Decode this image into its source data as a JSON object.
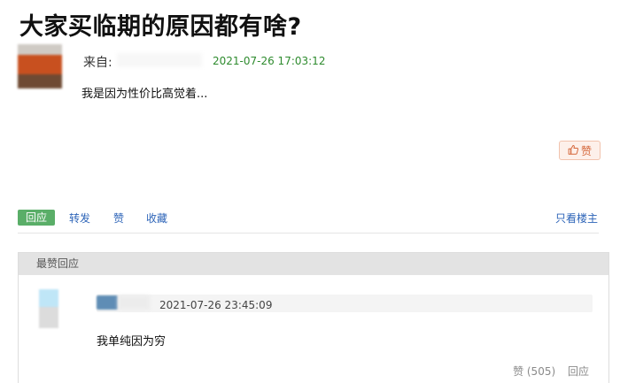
{
  "post": {
    "title": "大家买临期的原因都有啥?",
    "from_label": "来自:",
    "time": "2021-07-26 17:03:12",
    "body": "我是因为性价比高觉着...",
    "like_label": "赞"
  },
  "actions": {
    "reply": "回应",
    "forward": "转发",
    "like": "赞",
    "collect": "收藏",
    "only_op": "只看楼主"
  },
  "best_replies": {
    "header": "最赞回应",
    "items": [
      {
        "time": "2021-07-26 23:45:09",
        "text": "我单纯因为穷",
        "like_label": "赞 (505)",
        "reply_label": "回应"
      }
    ]
  },
  "icons": {
    "thumb": "thumbs-up-icon"
  },
  "colors": {
    "time_green": "#2e8b2e",
    "link_blue": "#2d64b8",
    "reply_tab_green": "#5aae68",
    "like_orange": "#d5673b"
  }
}
